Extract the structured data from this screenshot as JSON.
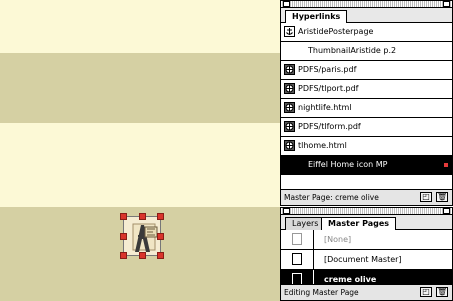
{
  "hyperlinks_panel": {
    "tab_label": "Hyperlinks",
    "items": [
      {
        "label": "AristidePosterpage",
        "icon": "anchor-icon"
      },
      {
        "label": "ThumbnailAristide p.2",
        "icon": "none"
      },
      {
        "label": "PDFS/paris.pdf",
        "icon": "url-link-icon"
      },
      {
        "label": "PDFS/tlport.pdf",
        "icon": "url-link-icon"
      },
      {
        "label": "nightlife.html",
        "icon": "url-link-icon"
      },
      {
        "label": "PDFS/tlform.pdf",
        "icon": "url-link-icon"
      },
      {
        "label": "tlhome.html",
        "icon": "url-link-icon"
      },
      {
        "label": "Eiffel Home icon MP",
        "icon": "none",
        "selected": true
      }
    ],
    "footer_label": "Master Page:  creme olive"
  },
  "pages_panel": {
    "tabs": [
      "Layers",
      "Master Pages"
    ],
    "active_tab": "Master Pages",
    "items": [
      {
        "label": "[None]",
        "dim": true
      },
      {
        "label": "[Document Master]"
      },
      {
        "label": "creme olive",
        "selected": true
      }
    ],
    "footer_label": "Editing Master Page"
  },
  "colors": {
    "cream": "#fcf9d6",
    "olive": "#d5d0a3",
    "selection": "#000000",
    "handle": "#d9342b"
  }
}
